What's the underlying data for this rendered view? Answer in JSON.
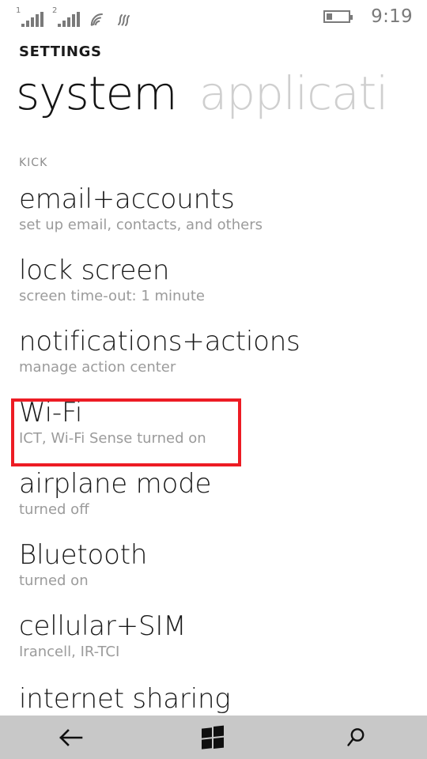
{
  "status_bar": {
    "sim1_label": "1",
    "sim2_label": "2",
    "sim1_icon": "signal-bars-icon",
    "sim2_icon": "signal-bars-icon",
    "wifi_icon": "wifi-icon",
    "data_icon": "cellular-data-icon",
    "battery_icon": "battery-low-icon",
    "time": "9:19"
  },
  "header": {
    "app_title": "SETTINGS",
    "tabs": [
      {
        "label": "system",
        "active": true
      },
      {
        "label": "applicati",
        "active": false
      }
    ]
  },
  "section": {
    "label": "KICK"
  },
  "settings": [
    {
      "title": "email+accounts",
      "subtitle": "set up email, contacts, and others"
    },
    {
      "title": "lock screen",
      "subtitle": "screen time-out: 1 minute"
    },
    {
      "title": "notifications+actions",
      "subtitle": "manage action center"
    },
    {
      "title": "Wi-Fi",
      "subtitle": "ICT, Wi-Fi Sense turned on"
    },
    {
      "title": "airplane mode",
      "subtitle": "turned off"
    },
    {
      "title": "Bluetooth",
      "subtitle": "turned on"
    },
    {
      "title": "cellular+SIM",
      "subtitle": "Irancell, IR-TCI"
    },
    {
      "title": "internet sharing",
      "subtitle": ""
    }
  ],
  "highlight": {
    "target": "Wi-Fi",
    "color": "#ed1c24"
  },
  "nav_bar": {
    "back_icon": "back-arrow-icon",
    "home_icon": "windows-logo-icon",
    "search_icon": "search-icon",
    "background_color": "#c8c8c8"
  }
}
